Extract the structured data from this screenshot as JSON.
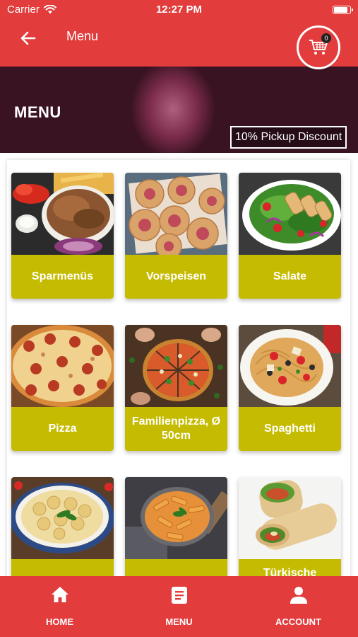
{
  "status_bar": {
    "carrier": "Carrier",
    "time": "12:27 PM",
    "battery_level": 0.9
  },
  "header": {
    "title": "Menu",
    "cart_count": "0"
  },
  "banner": {
    "title": "MENU",
    "badge": "10% Pickup Discount"
  },
  "categories": [
    {
      "label": "Sparmenüs",
      "icon": "kebab-platter-photo"
    },
    {
      "label": "Vorspeisen",
      "icon": "pizza-rolls-photo"
    },
    {
      "label": "Salate",
      "icon": "chicken-salad-photo"
    },
    {
      "label": "Pizza",
      "icon": "salami-pizza-photo"
    },
    {
      "label": "Familienpizza, Ø 50cm",
      "icon": "family-pizza-photo"
    },
    {
      "label": "Spaghetti",
      "icon": "spaghetti-photo"
    },
    {
      "label": "",
      "icon": "tortellini-photo"
    },
    {
      "label": "",
      "icon": "penne-photo"
    },
    {
      "label": "Türkische",
      "icon": "wrap-photo"
    }
  ],
  "bottom_nav": [
    {
      "label": "HOME",
      "icon": "home-icon"
    },
    {
      "label": "MENU",
      "icon": "menu-book-icon"
    },
    {
      "label": "ACCOUNT",
      "icon": "account-icon"
    }
  ],
  "colors": {
    "primary_red": "#e23c3c",
    "label_olive": "#c5bb00"
  }
}
